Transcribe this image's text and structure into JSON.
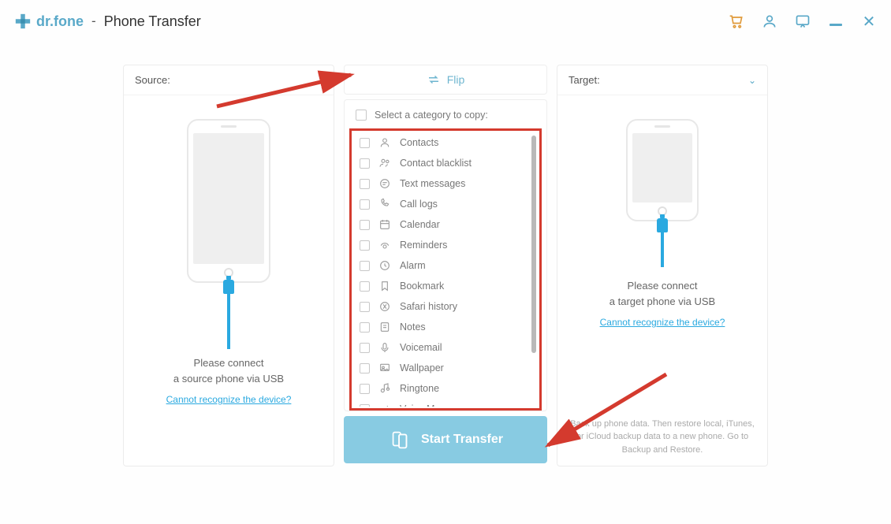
{
  "app": {
    "brand": "dr.fone",
    "title": "Phone Transfer"
  },
  "source": {
    "label": "Source:",
    "msg_line1": "Please connect",
    "msg_line2": "a source phone via USB",
    "help_link": "Cannot recognize the device?"
  },
  "target": {
    "label": "Target:",
    "msg_line1": "Please connect",
    "msg_line2": "a target phone via USB",
    "help_link": "Cannot recognize the device?",
    "footnote": "Back up phone data. Then restore local, iTunes, or iCloud backup data to a new phone. Go to Backup and Restore."
  },
  "center": {
    "flip_label": "Flip",
    "select_label": "Select a category to copy:",
    "categories": [
      "Contacts",
      "Contact blacklist",
      "Text messages",
      "Call logs",
      "Calendar",
      "Reminders",
      "Alarm",
      "Bookmark",
      "Safari history",
      "Notes",
      "Voicemail",
      "Wallpaper",
      "Ringtone",
      "Voice Memos"
    ],
    "start_label": "Start Transfer"
  }
}
